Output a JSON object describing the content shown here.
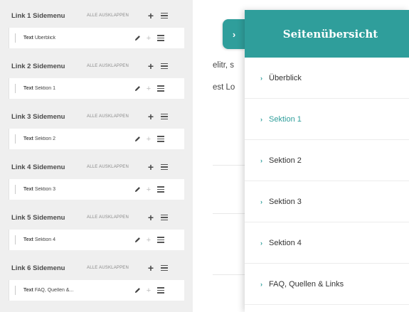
{
  "editor": {
    "expand_all_label": "ALLE AUSKLAPPEN",
    "groups": [
      {
        "title": "Link 1 Sidemenu",
        "item_prefix": "Text",
        "item_text": "Überblick"
      },
      {
        "title": "Link 2 Sidemenu",
        "item_prefix": "Text",
        "item_text": "Sektion 1"
      },
      {
        "title": "Link 3 Sidemenu",
        "item_prefix": "Text",
        "item_text": "Sektion 2"
      },
      {
        "title": "Link 4 Sidemenu",
        "item_prefix": "Text",
        "item_text": "Sektion 3"
      },
      {
        "title": "Link 5 Sidemenu",
        "item_prefix": "Text",
        "item_text": "Sektion 4"
      },
      {
        "title": "Link 6 Sidemenu",
        "item_prefix": "Text",
        "item_text": "FAQ, Quellen &..."
      }
    ]
  },
  "preview": {
    "bg_text_1": "elitr, s",
    "bg_text_2": "est Lo",
    "toggle_glyph": "›",
    "drawer_title": "Seitenübersicht",
    "nav_chevron": "›",
    "nav_items": [
      {
        "label": "Überblick"
      },
      {
        "label": "Sektion 1"
      },
      {
        "label": "Sektion 2"
      },
      {
        "label": "Sektion 3"
      },
      {
        "label": "Sektion 4"
      },
      {
        "label": "FAQ, Quellen & Links"
      }
    ],
    "active_index": 1
  },
  "colors": {
    "accent": "#2f9e9b",
    "panel_bg": "#efefef"
  }
}
